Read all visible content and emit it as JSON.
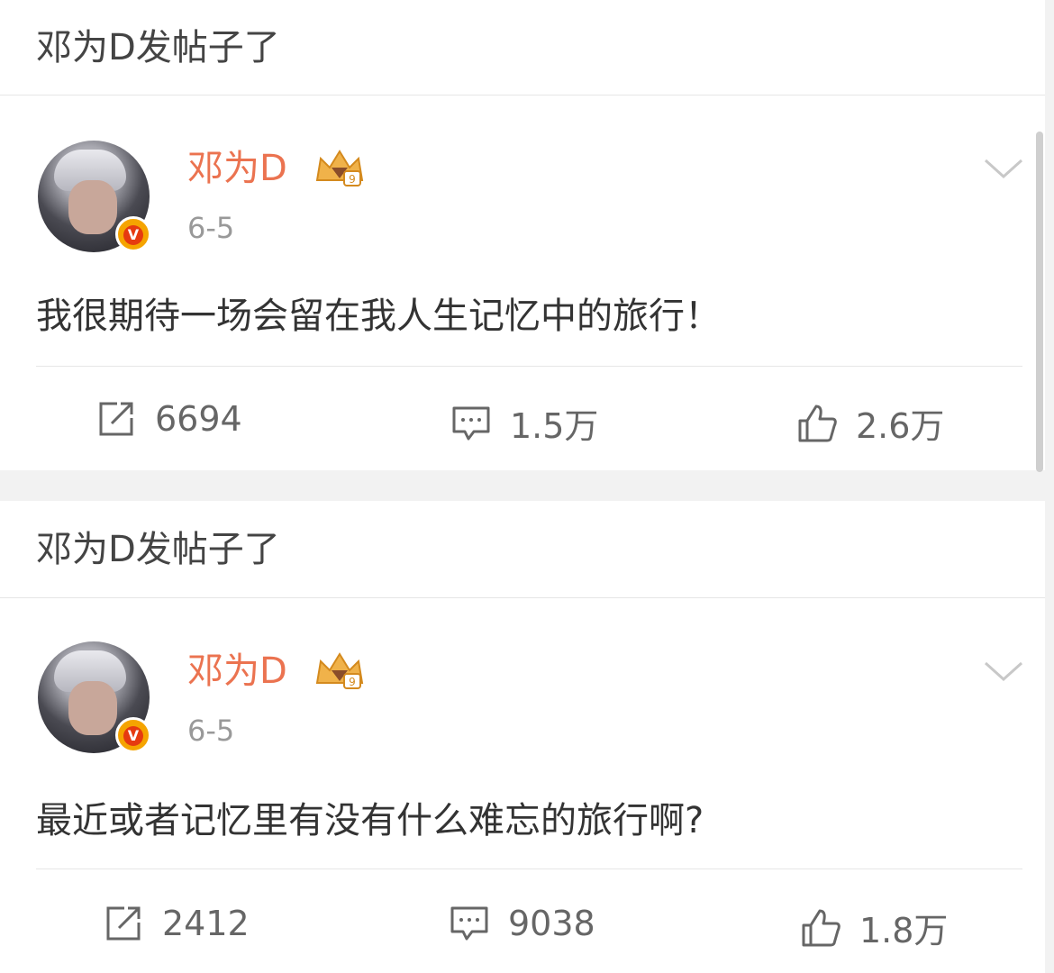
{
  "posts": [
    {
      "header": "邓为D发帖子了",
      "username": "邓为D",
      "date": "6-5",
      "content": "我很期待一场会留在我人生记忆中的旅行！",
      "actions": {
        "repost": "6694",
        "comment": "1.5万",
        "like": "2.6万"
      }
    },
    {
      "header": "邓为D发帖子了",
      "username": "邓为D",
      "date": "6-5",
      "content": "最近或者记忆里有没有什么难忘的旅行啊?",
      "actions": {
        "repost": "2412",
        "comment": "9038",
        "like": "1.8万"
      }
    }
  ],
  "icons": {
    "verified": "verified-v-badge-icon",
    "member": "crown-member-icon",
    "more": "chevron-down-icon",
    "repost": "repost-icon",
    "comment": "comment-icon",
    "like": "thumbs-up-icon"
  },
  "colors": {
    "username": "#eb7350",
    "verified": "#f5a400",
    "crown": "#f0b24a"
  }
}
